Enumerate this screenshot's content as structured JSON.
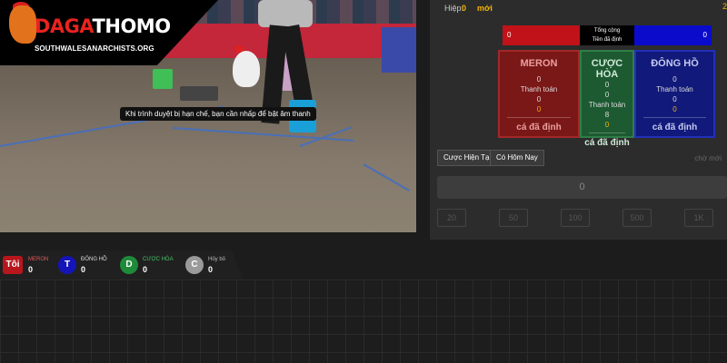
{
  "brand": {
    "name_red": "DAGA",
    "name_white": "THOMO",
    "site": "SOUTHWALESANARCHISTS.ORG",
    "accent": "#e8231f"
  },
  "video": {
    "caption": "Khi trình duyệt bị hạn chế, bạn cần nhấp để bật âm thanh"
  },
  "header": {
    "hiep_label": "Hiệp:",
    "hiep_value": "0",
    "moi": "mới",
    "corner": "2"
  },
  "totals": {
    "left_value": "0",
    "center_line1": "Tổng cộng",
    "center_line2": "Tiền đã định",
    "right_value": "0"
  },
  "boxes": [
    {
      "title": "MERON",
      "v1": "0",
      "label": "Thanh toán",
      "v2": "0",
      "v3": "0",
      "done": "cá đã định",
      "color": "#7a1717"
    },
    {
      "title": "CƯỢC HÒA",
      "v1": "0",
      "v1b": "0",
      "label": "Thanh toán",
      "v2": "8",
      "v3": "0",
      "done": "cá đã định",
      "color": "#1d5a32"
    },
    {
      "title": "ĐÔNG HỒ",
      "v1": "0",
      "label": "Thanh toán",
      "v2": "0",
      "v3": "0",
      "done": "cá đã định",
      "color": "#11197a"
    }
  ],
  "tabs": {
    "current": "Cược Hiện Tại",
    "today": "Có Hôm Nay",
    "right_label": "chờ mới"
  },
  "bet": {
    "amount": "0",
    "chips": [
      "20",
      "50",
      "100",
      "500",
      "1K"
    ]
  },
  "stats": [
    {
      "badge": "Tôi",
      "label": "MERON",
      "value": "0",
      "color": "#b7161c",
      "label_color": "#e05a5a"
    },
    {
      "badge": "T",
      "label": "ĐÔNG HỒ",
      "value": "0",
      "color": "#1414b8",
      "label_color": "#dddddd"
    },
    {
      "badge": "D",
      "label": "CƯỢC HÒA",
      "value": "0",
      "color": "#1f8a3a",
      "label_color": "#4cc46b"
    },
    {
      "badge": "C",
      "label": "Hủy bỏ",
      "value": "0",
      "color": "#9a9a9a",
      "label_color": "#bbbbbb"
    }
  ]
}
